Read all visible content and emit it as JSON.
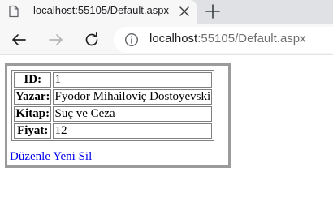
{
  "browser": {
    "tab_title": "localhost:55105/Default.aspx",
    "url_host": "localhost",
    "url_rest": ":55105/Default.aspx"
  },
  "details": {
    "rows": [
      {
        "label": "ID:",
        "value": "1"
      },
      {
        "label": "Yazar:",
        "value": "Fyodor Mihailoviç Dostoyevski"
      },
      {
        "label": "Kitap:",
        "value": "Suç ve Ceza"
      },
      {
        "label": "Fiyat:",
        "value": "12"
      }
    ],
    "actions": {
      "edit": "Düzenle",
      "new": "Yeni",
      "delete": "Sil"
    }
  },
  "colors": {
    "tabbar": "#dfe1e5",
    "toolbar": "#f7f7f7",
    "link": "#0000ee",
    "frame_border": "#9b9b9b"
  },
  "icons": {
    "tab": "page-icon",
    "close": "close-icon",
    "new_tab": "plus-icon",
    "back": "arrow-left-icon",
    "forward": "arrow-right-icon",
    "reload": "reload-icon",
    "site_info": "info-icon"
  }
}
